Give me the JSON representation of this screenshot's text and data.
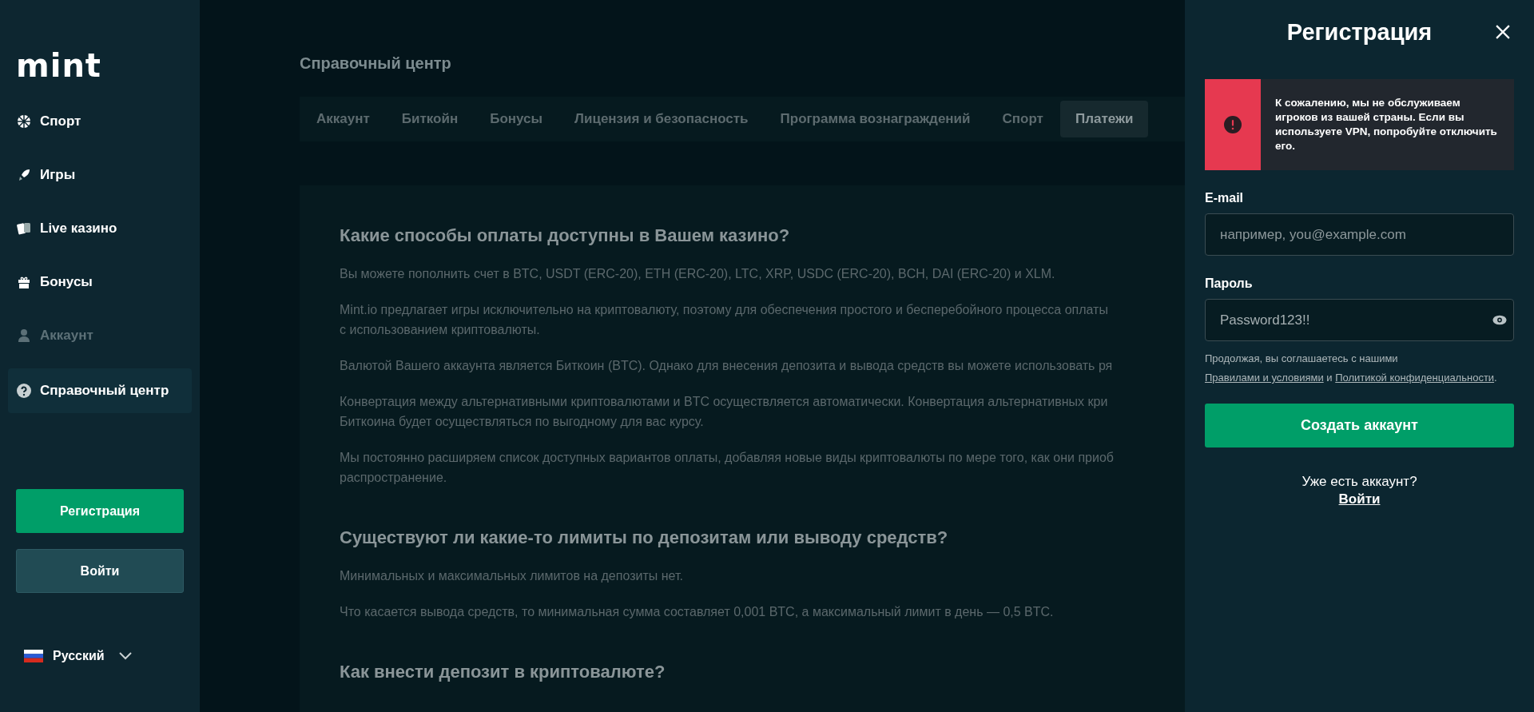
{
  "sidebar": {
    "logo": "mint",
    "items": [
      {
        "label": "Спорт",
        "selected": false,
        "disabled": false
      },
      {
        "label": "Игры",
        "selected": false,
        "disabled": false
      },
      {
        "label": "Live казино",
        "selected": false,
        "disabled": false
      },
      {
        "label": "Бонусы",
        "selected": false,
        "disabled": false
      },
      {
        "label": "Аккаунт",
        "selected": false,
        "disabled": true
      },
      {
        "label": "Справочный центр",
        "selected": true,
        "disabled": false
      }
    ],
    "buttons": [
      {
        "label": "Регистрация",
        "kind": "primary"
      },
      {
        "label": "Войти",
        "kind": "secondary"
      }
    ],
    "language": "Русский"
  },
  "main": {
    "title": "Справочный центр",
    "tabs": [
      {
        "label": "Аккаунт",
        "selected": false
      },
      {
        "label": "Биткойн",
        "selected": false
      },
      {
        "label": "Бонусы",
        "selected": false
      },
      {
        "label": "Лицензия и безопасность",
        "selected": false
      },
      {
        "label": "Программа вознаграждений",
        "selected": false
      },
      {
        "label": "Спорт",
        "selected": false
      },
      {
        "label": "Платежи",
        "selected": true
      }
    ],
    "sections": [
      {
        "heading": "Какие способы оплаты доступны в Вашем казино?",
        "paragraphs": [
          [
            "Вы можете пополнить счет в BTC, USDT (ERC-20), ETH (ERC-20), LTC, XRP, USDC (ERC-20), BCH, DAI (ERC-20) и XLM."
          ],
          [
            "Mint.io предлагает игры исключительно на криптовалюту, поэтому для обеспечения простого и бесперебойного процесса оплаты",
            "с использованием криптовалюты."
          ],
          [
            "Валютой Вашего аккаунта является Биткоин (BTC). Однако для внесения депозита и вывода средств вы можете использовать ря"
          ],
          [
            "Конвертация между альтернативными криптовалютами и BTC осуществляется автоматически. Конвертация альтернативных кри",
            "Биткоина будет осуществляться по выгодному для вас курсу."
          ],
          [
            "Мы постоянно расширяем список доступных вариантов оплаты, добавляя новые виды криптовалюты по мере того, как они приоб",
            "распространение."
          ]
        ]
      },
      {
        "heading": "Существуют ли какие-то лимиты по депозитам или выводу средств?",
        "paragraphs": [
          [
            "Минимальных и максимальных лимитов на депозиты нет."
          ],
          [
            "Что касается вывода средств, то минимальная сумма составляет 0,001 BTC, а максимальный лимит в день — 0,5 BTC."
          ]
        ]
      },
      {
        "heading": "Как внести депозит в криптовалюте?"
      }
    ]
  },
  "panel": {
    "title": "Регистрация",
    "alert": "К сожалению, мы не обслуживаем игроков из вашей страны. Если вы используете VPN, попробуйте отключить его.",
    "email": {
      "label": "E-mail",
      "placeholder": "например, you@example.com"
    },
    "password": {
      "label": "Пароль",
      "value": "Password123!!"
    },
    "terms": {
      "text": "Продолжая, вы соглашаетесь с нашими",
      "link_1": "Правилами и условиями",
      "joiner": "и",
      "link_2": "Политикой конфиденциальности",
      "end": "."
    },
    "submit": "Создать аккаунт",
    "have_account": "Уже есть аккаунт?",
    "login_link": "Войти"
  }
}
